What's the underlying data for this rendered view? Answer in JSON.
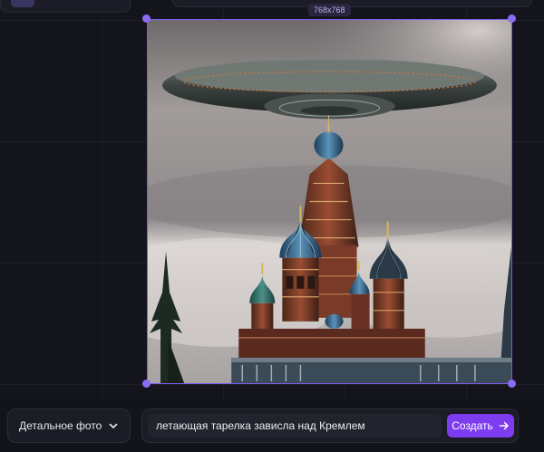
{
  "canvas": {
    "size_label": "768x768",
    "image_alt": "летающая тарелка зависла над Кремлем"
  },
  "controls": {
    "style_select": {
      "value": "Детальное фото",
      "icon": "chevron-down-icon"
    },
    "prompt": {
      "value": "летающая тарелка зависла над Кремлем",
      "placeholder": ""
    },
    "create_button": {
      "label": "Создать",
      "icon": "arrow-right-icon"
    }
  },
  "colors": {
    "accent": "#7d3cf0",
    "selection": "#8d6cf5",
    "background": "#14141c"
  }
}
